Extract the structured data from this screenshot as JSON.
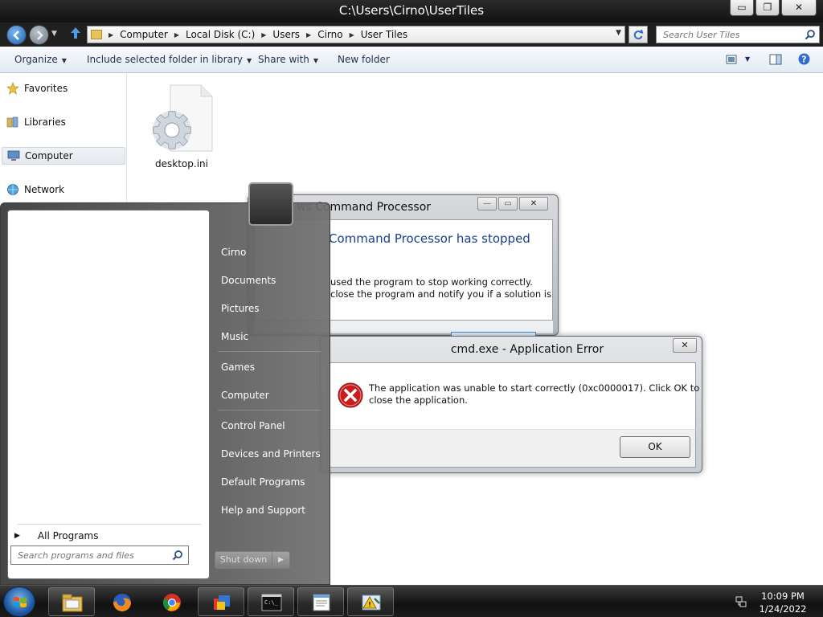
{
  "window": {
    "title": "C:\\Users\\Cirno\\UserTiles",
    "minimize_glyph": "▭",
    "restore_glyph": "❐",
    "close_glyph": "✕"
  },
  "address": {
    "crumbs": [
      "Computer",
      "Local Disk (C:)",
      "Users",
      "Cirno",
      "User Tiles"
    ],
    "search_placeholder": "Search User Tiles"
  },
  "toolbar": {
    "organize": "Organize",
    "include_library": "Include selected folder in library",
    "share_with": "Share with",
    "new_folder": "New folder"
  },
  "nav": {
    "favorites": "Favorites",
    "libraries": "Libraries",
    "computer": "Computer",
    "network": "Network"
  },
  "files": [
    {
      "name": "desktop.ini",
      "icon": "settings-file-icon"
    }
  ],
  "cmd_dialog": {
    "title": "ws Command Processor",
    "heading": "Command Processor has stopped",
    "line1": "used the program to stop working correctly.",
    "line2": "close the program and notify you if a solution is"
  },
  "error_dialog": {
    "title": "cmd.exe - Application Error",
    "line1": "The application was unable to start correctly (0xc0000017). Click OK to",
    "line2": "close the application.",
    "ok": "OK",
    "close_glyph": "✕"
  },
  "start_menu": {
    "right_items": [
      "Cirno",
      "Documents",
      "Pictures",
      "Music",
      "Games",
      "Computer",
      "Control Panel",
      "Devices and Printers",
      "Default Programs",
      "Help and Support"
    ],
    "all_programs": "All Programs",
    "search_placeholder": "Search programs and files",
    "shutdown": "Shut down"
  },
  "taskbar": {
    "apps": [
      "explorer-icon",
      "firefox-icon",
      "chrome-icon",
      "paint-icon",
      "cmd-icon",
      "notepad-icon",
      "error-reporting-icon"
    ],
    "time": "10:09 PM",
    "date": "1/24/2022"
  },
  "colors": {
    "dialog_heading": "#1a3d8f",
    "error_red": "#c81e1e",
    "taskbar": "#1a1a1a"
  }
}
